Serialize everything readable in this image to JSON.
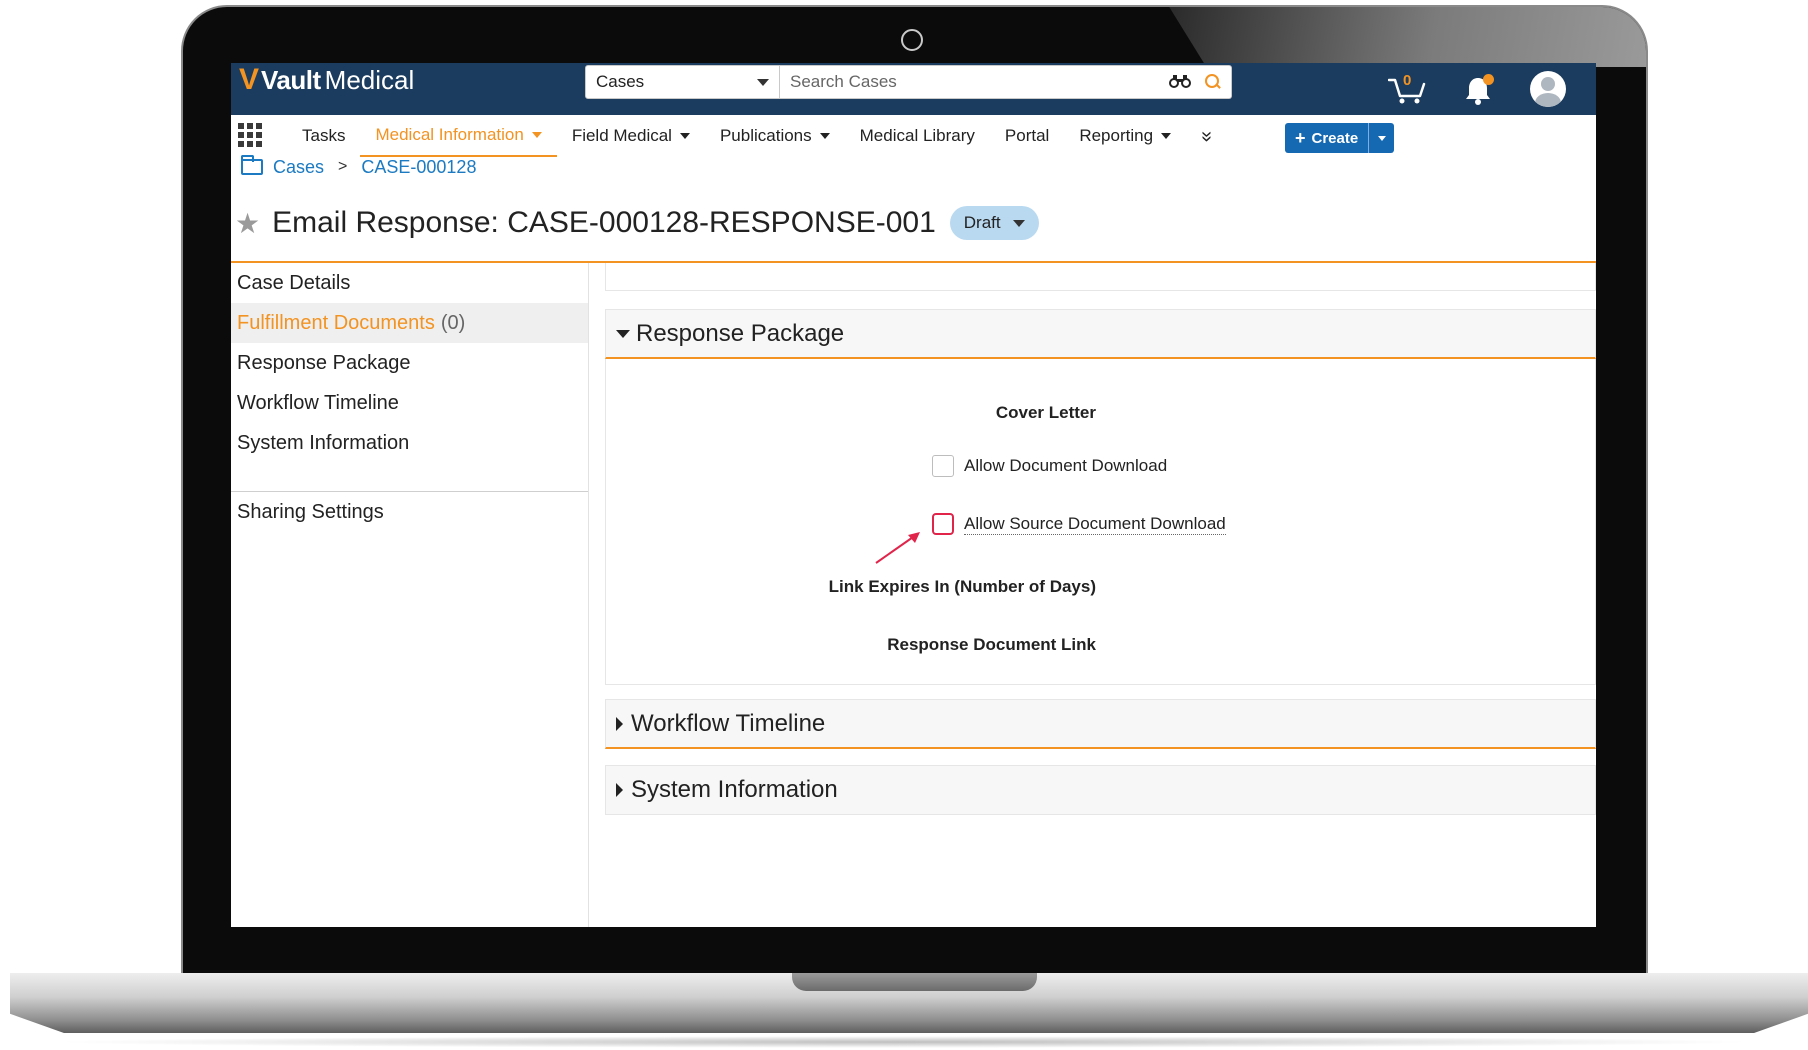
{
  "app": {
    "logo_mark": "V",
    "logo_word1": "Vault",
    "logo_word2": "Medical"
  },
  "search": {
    "scope": "Cases",
    "placeholder": "Search Cases"
  },
  "topbar": {
    "cart_count": "0"
  },
  "nav": {
    "items": [
      {
        "label": "Tasks"
      },
      {
        "label": "Medical Information"
      },
      {
        "label": "Field Medical"
      },
      {
        "label": "Publications"
      },
      {
        "label": "Medical Library"
      },
      {
        "label": "Portal"
      },
      {
        "label": "Reporting"
      }
    ],
    "more_icon": "»",
    "create_label": "Create"
  },
  "breadcrumb": {
    "root": "Cases",
    "current": "CASE-000128"
  },
  "page": {
    "title": "Email Response: CASE-000128-RESPONSE-001",
    "status": "Draft"
  },
  "sidebar": {
    "items": [
      {
        "label": "Case Details"
      },
      {
        "label": "Fulfillment Documents",
        "count": "(0)"
      },
      {
        "label": "Response Package"
      },
      {
        "label": "Workflow Timeline"
      },
      {
        "label": "System Information"
      }
    ],
    "sharing": "Sharing Settings"
  },
  "sections": {
    "response_package": {
      "title": "Response Package",
      "cover_letter_label": "Cover Letter",
      "allow_doc_download": "Allow Document Download",
      "allow_source_download": "Allow Source Document Download",
      "link_expires_label": "Link Expires In (Number of Days)",
      "response_link_label": "Response Document Link"
    },
    "workflow_timeline": {
      "title": "Workflow Timeline"
    },
    "system_information": {
      "title": "System Information"
    }
  },
  "colors": {
    "brand_orange": "#f29322",
    "header_navy": "#1b3c5e",
    "link_blue": "#1b7ac2",
    "create_blue": "#1569b3",
    "annotation_red": "#e0244a"
  }
}
